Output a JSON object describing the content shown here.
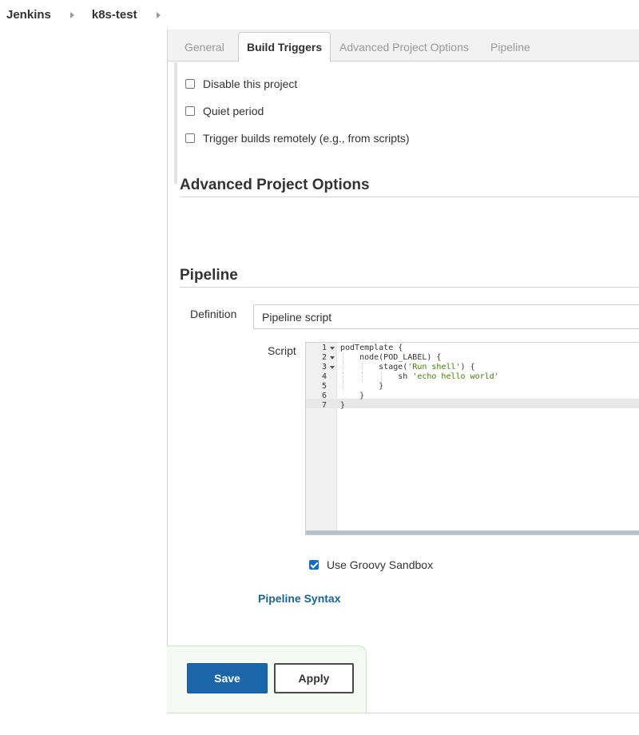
{
  "breadcrumb": {
    "items": [
      "Jenkins",
      "k8s-test"
    ]
  },
  "tabs": [
    {
      "label": "General",
      "active": false
    },
    {
      "label": "Build Triggers",
      "active": true
    },
    {
      "label": "Advanced Project Options",
      "active": false
    },
    {
      "label": "Pipeline",
      "active": false
    }
  ],
  "triggers": {
    "options": [
      {
        "label": "Disable this project",
        "checked": false
      },
      {
        "label": "Quiet period",
        "checked": false
      },
      {
        "label": "Trigger builds remotely (e.g., from scripts)",
        "checked": false
      }
    ]
  },
  "sections": {
    "advanced_title": "Advanced Project Options",
    "pipeline_title": "Pipeline"
  },
  "pipeline": {
    "definition_label": "Definition",
    "definition_value": "Pipeline script",
    "script_label": "Script",
    "script_lines": [
      "podTemplate {",
      "    node(POD_LABEL) {",
      "        stage('Run shell') {",
      "            sh 'echo hello world'",
      "        }",
      "    }",
      "}"
    ],
    "line_numbers": [
      "1",
      "2",
      "3",
      "4",
      "5",
      "6",
      "7"
    ],
    "sandbox_label": "Use Groovy Sandbox",
    "sandbox_checked": true,
    "syntax_link": "Pipeline Syntax"
  },
  "actions": {
    "save_label": "Save",
    "apply_label": "Apply"
  },
  "colors": {
    "primary_button": "#1b66a8",
    "link": "#1a6496",
    "string_token": "#4a7a00"
  }
}
